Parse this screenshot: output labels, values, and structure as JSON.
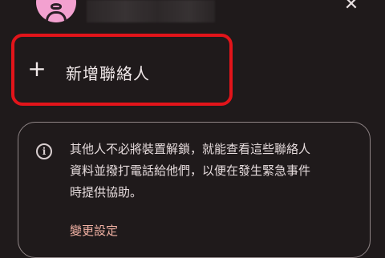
{
  "header": {
    "close_label": "✕"
  },
  "add_contact": {
    "icon": "+",
    "label": "新增聯絡人"
  },
  "info_card": {
    "icon": "i",
    "lines": [
      "其他人不必將裝置解鎖，就能查看這些聯絡人",
      "資料並撥打電話給他們，以便在發生緊急事件",
      "時提供協助。"
    ],
    "link_label": "變更設定"
  },
  "colors": {
    "background": "#1f1a1b",
    "highlight_border": "#e2141a",
    "avatar": "#f3a1d0",
    "link": "#f2b2a4"
  }
}
